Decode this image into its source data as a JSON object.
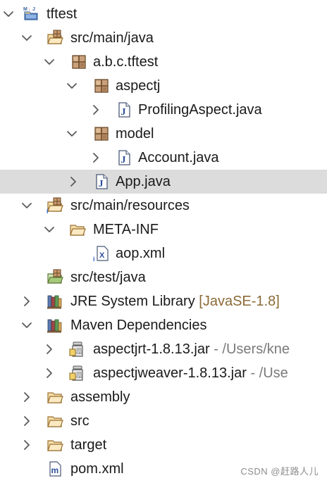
{
  "tree": {
    "project": {
      "name": "tftest"
    },
    "src_main_java": {
      "label": "src/main/java"
    },
    "pkg_abc": {
      "label": "a.b.c.tftest"
    },
    "pkg_aspectj": {
      "label": "aspectj"
    },
    "file_profiling": {
      "label": "ProfilingAspect.java"
    },
    "pkg_model": {
      "label": "model"
    },
    "file_account": {
      "label": "Account.java"
    },
    "file_app": {
      "label": "App.java"
    },
    "src_main_resources": {
      "label": "src/main/resources"
    },
    "meta_inf": {
      "label": "META-INF"
    },
    "aop_xml": {
      "label": "aop.xml"
    },
    "src_test_java": {
      "label": "src/test/java"
    },
    "jre": {
      "label": "JRE System Library",
      "decoration": "[JavaSE-1.8]"
    },
    "maven_deps": {
      "label": "Maven Dependencies"
    },
    "jar_aspectjrt": {
      "label": "aspectjrt-1.8.13.jar",
      "decoration": "- /Users/kne"
    },
    "jar_aspectjweaver": {
      "label": "aspectjweaver-1.8.13.jar",
      "decoration": "- /Use"
    },
    "assembly": {
      "label": "assembly"
    },
    "src": {
      "label": "src"
    },
    "target": {
      "label": "target"
    },
    "pom": {
      "label": "pom.xml"
    }
  },
  "watermark": "CSDN @赶路人儿",
  "colors": {
    "selected_row": "#dcdcdc",
    "decoration_brown": "#8a6a36",
    "decoration_gray": "#7a7a7a",
    "chevron": "#5a5a5a"
  }
}
